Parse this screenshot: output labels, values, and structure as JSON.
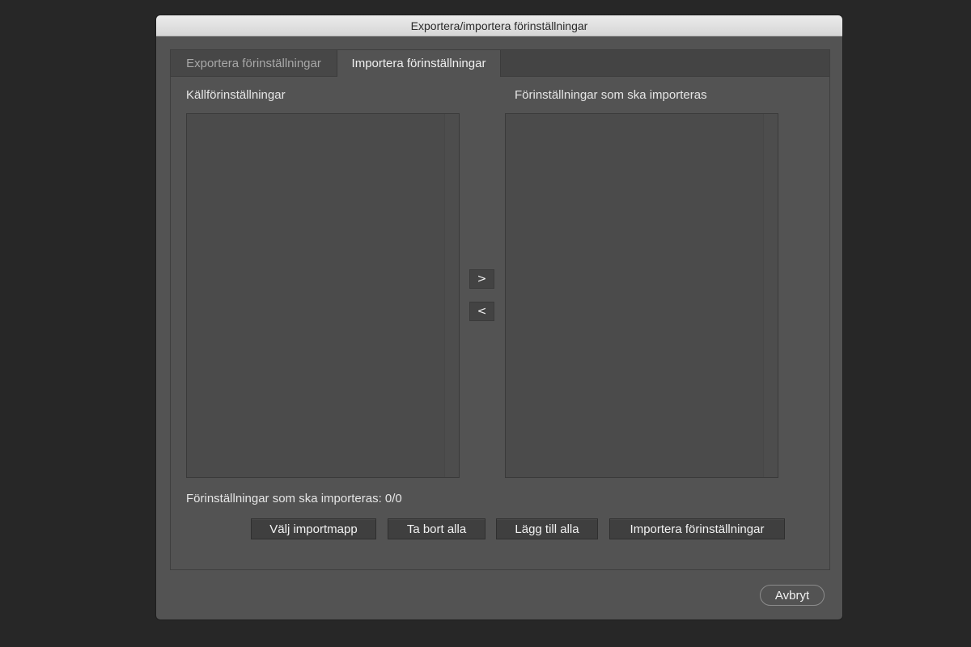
{
  "window": {
    "title": "Exportera/importera förinställningar"
  },
  "tabs": [
    {
      "label": "Exportera förinställningar",
      "active": false
    },
    {
      "label": "Importera förinställningar",
      "active": true
    }
  ],
  "source_list": {
    "label": "Källförinställningar",
    "items": []
  },
  "target_list": {
    "label": "Förinställningar som ska importeras",
    "items": []
  },
  "transfer": {
    "add_label": ">",
    "remove_label": "<"
  },
  "status": {
    "text": "Förinställningar som ska importeras: 0/0"
  },
  "actions": {
    "choose_folder": "Välj importmapp",
    "remove_all": "Ta bort alla",
    "add_all": "Lägg till alla",
    "import": "Importera förinställningar"
  },
  "footer": {
    "cancel": "Avbryt"
  },
  "colors": {
    "background": "#272727",
    "dialog": "#535353",
    "titlebar": "#dcdcdc",
    "list": "#4b4b4b",
    "button": "#3f3f3f",
    "text": "#e6e6e6"
  }
}
